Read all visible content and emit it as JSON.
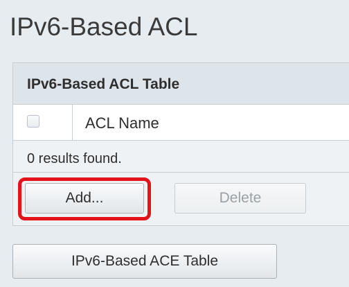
{
  "page": {
    "title": "IPv6-Based ACL"
  },
  "acl_table": {
    "title": "IPv6-Based ACL Table",
    "columns": [
      "ACL Name"
    ],
    "rows": [],
    "results_text": "0 results found."
  },
  "buttons": {
    "add_label": "Add...",
    "delete_label": "Delete",
    "ace_table_label": "IPv6-Based ACE Table"
  },
  "highlight": {
    "color": "#e3131b",
    "target": "add-button"
  }
}
